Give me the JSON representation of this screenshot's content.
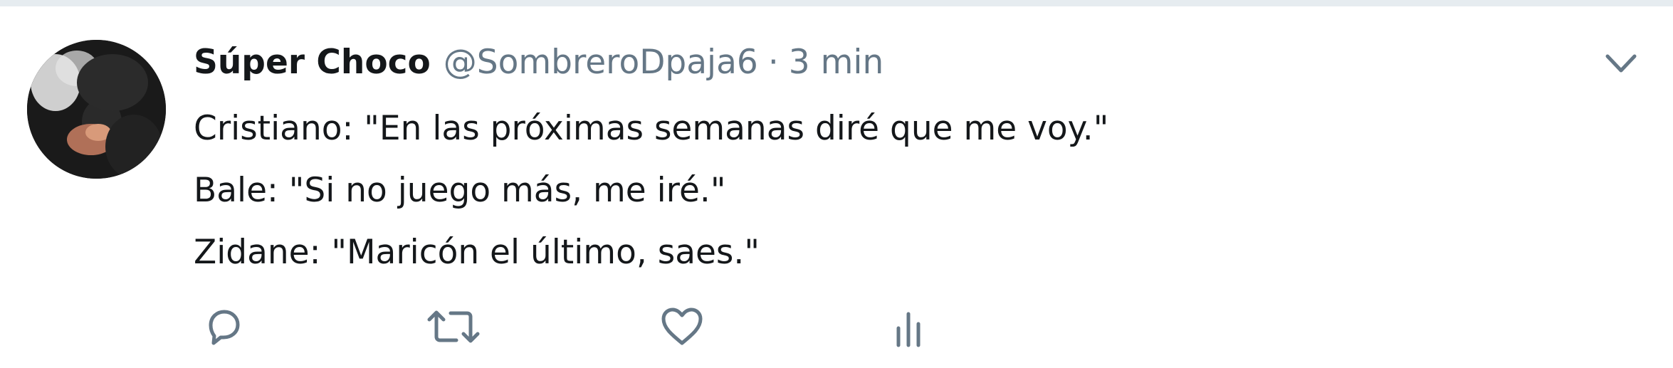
{
  "tweet": {
    "author_name": "Súper Choco",
    "author_handle": "@SombreroDpaja6",
    "separator": "·",
    "timestamp": "3 min",
    "lines": [
      "Cristiano: \"En las próximas semanas diré que me voy.\"",
      "Bale: \"Si no juego más, me iré.\"",
      "Zidane: \"Maricón el último, saes.\""
    ]
  },
  "icons": {
    "menu": "chevron-down-icon",
    "reply": "reply-icon",
    "retweet": "retweet-icon",
    "like": "heart-icon",
    "analytics": "analytics-icon"
  },
  "colors": {
    "text": "#14171a",
    "secondary": "#657786",
    "divider": "#e6ecf0"
  }
}
